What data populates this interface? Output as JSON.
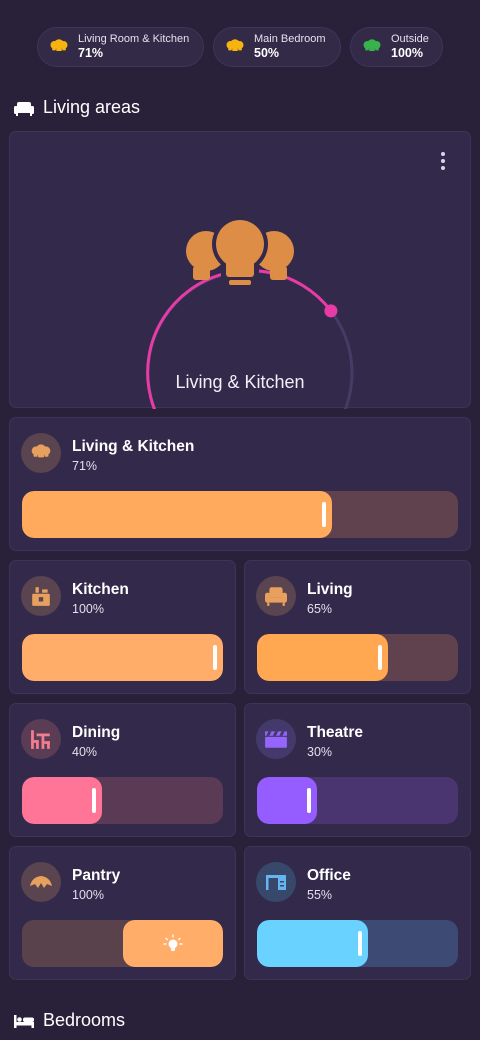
{
  "chips": [
    {
      "name": "Living Room & Kitchen",
      "value": "71%",
      "icon": "lightbulb-group-icon",
      "color": "#f5b40f"
    },
    {
      "name": "Main Bedroom",
      "value": "50%",
      "icon": "lightbulb-group-icon",
      "color": "#f5b40f"
    },
    {
      "name": "Outside",
      "value": "100%",
      "icon": "lightbulb-group-icon",
      "color": "#38b24a"
    }
  ],
  "sections": {
    "living": {
      "title": "Living areas",
      "icon": "sofa-icon"
    },
    "bedrooms": {
      "title": "Bedrooms",
      "icon": "bed-icon"
    }
  },
  "hero": {
    "title": "Living & Kitchen",
    "level": 0.71,
    "arc_color": "#e83ba5",
    "icon_color": "#dd8d46",
    "icon": "lightbulb-group-icon",
    "menu_icon": "more-vertical-icon"
  },
  "tiles": [
    {
      "name": "Living & Kitchen",
      "value": "71%",
      "level": 0.71,
      "icon": "lightbulb-group-icon",
      "icon_color": "#e8a05e",
      "icon_bg": "#5a4450",
      "fill": "#ffaa5c",
      "track": "#5f424d"
    },
    {
      "name": "Kitchen",
      "value": "100%",
      "level": 1.0,
      "icon": "stove-icon",
      "icon_color": "#e8a05e",
      "icon_bg": "#5a4450",
      "fill": "#ffad68",
      "track": "#5f424d"
    },
    {
      "name": "Living",
      "value": "65%",
      "level": 0.65,
      "icon": "armchair-icon",
      "icon_color": "#e8a05e",
      "icon_bg": "#5a4450",
      "fill": "#ffa751",
      "track": "#5f424d"
    },
    {
      "name": "Dining",
      "value": "40%",
      "level": 0.4,
      "icon": "dining-table-icon",
      "icon_color": "#f27c92",
      "icon_bg": "#5a3d55",
      "fill": "#ff7597",
      "track": "#5a3a55"
    },
    {
      "name": "Theatre",
      "value": "30%",
      "level": 0.3,
      "icon": "clapperboard-icon",
      "icon_color": "#9665ff",
      "icon_bg": "#433a6b",
      "fill": "#955cff",
      "track": "#4a3570"
    },
    {
      "name": "Pantry",
      "value": "100%",
      "level": 1.0,
      "icon": "croissant-icon",
      "icon_color": "#e8a05e",
      "icon_bg": "#5a4450",
      "fill": "#ffad68",
      "track": "#5a424d",
      "mode": "toggle",
      "toggle_icon": "lightbulb-on-icon"
    },
    {
      "name": "Office",
      "value": "55%",
      "level": 0.55,
      "icon": "desk-icon",
      "icon_color": "#64b5f0",
      "icon_bg": "#37486b",
      "fill": "#69d2ff",
      "track": "#3d4a73"
    }
  ]
}
